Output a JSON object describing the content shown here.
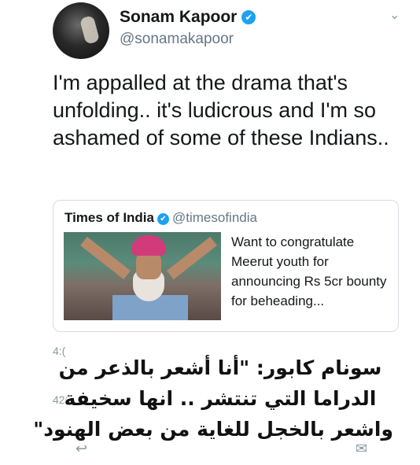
{
  "tweet": {
    "author_name": "Sonam Kapoor",
    "author_handle": "@sonamakapoor",
    "verified_glyph": "✔",
    "menu_glyph": "⌄",
    "text": "I'm appalled at the drama that's unfolding.. it's ludicrous and I'm so ashamed of some of these Indians.."
  },
  "quoted": {
    "author_name": "Times of India",
    "author_handle": "@timesofindia",
    "text": "Want to congratulate Meerut youth for announcing Rs 5cr bounty for beheading..."
  },
  "stats": {
    "line1_partial": "4:(",
    "line2_partial": "420"
  },
  "actions": {
    "reply_glyph": "↩",
    "dm_glyph": "✉"
  },
  "overlay": {
    "lines": [
      "سونام كابور: \"أنا أشعر بالذعر من",
      "الدراما التي تنتشر .. انها سخيفة",
      "واشعر بالخجل للغاية من بعض الهنود\""
    ]
  },
  "colors": {
    "verified": "#1da1f2",
    "secondary_text": "#657786",
    "border": "#d8dde2"
  }
}
